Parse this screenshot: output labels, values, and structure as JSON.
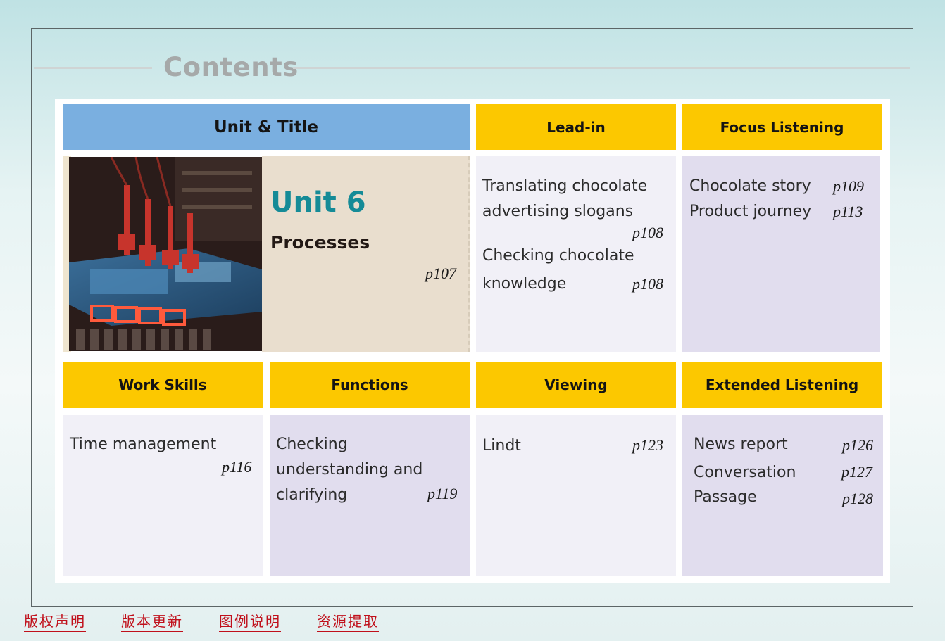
{
  "page_title": "Contents",
  "headers": {
    "unit_title": "Unit & Title",
    "lead_in": "Lead-in",
    "focus_listening": "Focus Listening",
    "work_skills": "Work Skills",
    "functions": "Functions",
    "viewing": "Viewing",
    "extended_listening": "Extended Listening"
  },
  "unit": {
    "number": "Unit 6",
    "name": "Processes",
    "page": "p107"
  },
  "lead_in": [
    {
      "line1": "Translating chocolate",
      "line2": "advertising slogans",
      "page": "p108"
    },
    {
      "line1": "Checking chocolate",
      "line2": "knowledge",
      "page": "p108"
    }
  ],
  "focus_listening": [
    {
      "text": "Chocolate story",
      "page": "p109"
    },
    {
      "text": "Product journey",
      "page": "p113"
    }
  ],
  "work_skills": [
    {
      "text": "Time management",
      "page": "p116"
    }
  ],
  "functions": {
    "line1": "Checking",
    "line2": "understanding and",
    "line3": "clarifying",
    "page": "p119"
  },
  "viewing": [
    {
      "text": "Lindt",
      "page": "p123"
    }
  ],
  "extended_listening": [
    {
      "text": "News report",
      "page": "p126"
    },
    {
      "text": "Conversation",
      "page": "p127"
    },
    {
      "text": "Passage",
      "page": "p128"
    }
  ],
  "footer_links": [
    "版权声明",
    "版本更新",
    "图例说明",
    "资源提取"
  ],
  "colors": {
    "header_blue": "#7aafe0",
    "header_yellow": "#fcc800",
    "unit_teal": "#158b97",
    "footer_red": "#c0101b"
  }
}
